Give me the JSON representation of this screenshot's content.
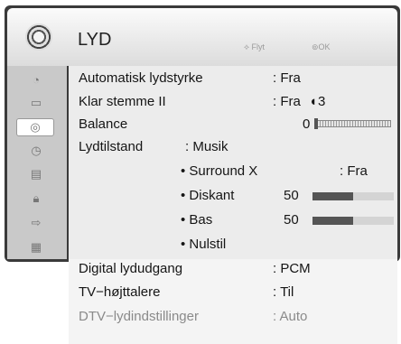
{
  "header": {
    "title": "LYD",
    "nav_hint": "⟡ Flyt",
    "ok_hint": "⊚OK"
  },
  "sidebar": [
    "picture",
    "screen",
    "audio",
    "clock",
    "option",
    "lock",
    "input",
    "usb"
  ],
  "rows": [
    {
      "label": "Automatisk lydstyrke",
      "value": ": Fra"
    },
    {
      "label": "Klar stemme II",
      "value": ": Fra",
      "extra": "3"
    },
    {
      "label": "Balance",
      "value": "0"
    },
    {
      "label": "Lydtilstand",
      "value": ": Musik"
    },
    {
      "label": "• Surround X",
      "value": ": Fra"
    },
    {
      "label": "• Diskant",
      "value": "50",
      "level": 0.5
    },
    {
      "label": "• Bas",
      "value": "50",
      "level": 0.5
    },
    {
      "label": "• Nulstil"
    },
    {
      "label": "Digital lydudgang",
      "value": ": PCM"
    },
    {
      "label": "TV−højttalere",
      "value": ": Til"
    },
    {
      "label": "DTV−lydindstillinger",
      "value": ": Auto"
    }
  ]
}
